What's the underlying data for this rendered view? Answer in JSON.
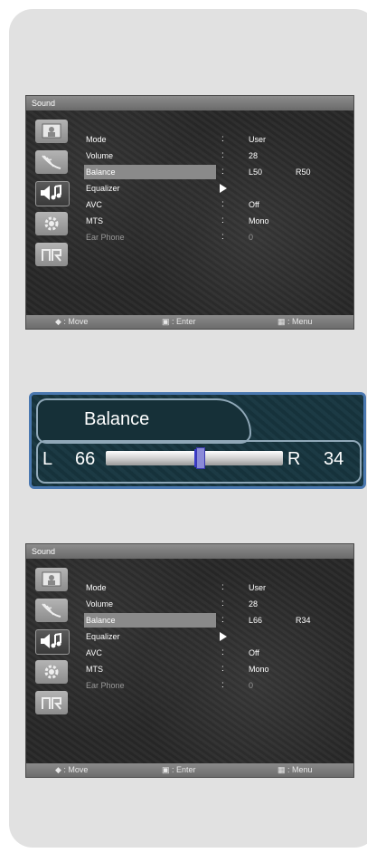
{
  "menus": [
    {
      "title": "Sound",
      "items": [
        {
          "label": "Mode",
          "sep": ":",
          "value": "User",
          "value2": ""
        },
        {
          "label": "Volume",
          "sep": ":",
          "value": "28",
          "value2": ""
        },
        {
          "label": "Balance",
          "sep": ":",
          "value": "L50",
          "value2": "R50",
          "selected": true
        },
        {
          "label": "Equalizer",
          "sep": "",
          "value": "",
          "value2": "",
          "submenu": true
        },
        {
          "label": "AVC",
          "sep": ":",
          "value": "Off",
          "value2": ""
        },
        {
          "label": "MTS",
          "sep": ":",
          "value": "Mono",
          "value2": ""
        },
        {
          "label": "Ear Phone",
          "sep": ":",
          "value": "0",
          "value2": "",
          "disabled": true
        }
      ],
      "footer": {
        "move": "◆ : Move",
        "enter": "▣ : Enter",
        "menu": "▦ : Menu"
      }
    },
    {
      "title": "Sound",
      "items": [
        {
          "label": "Mode",
          "sep": ":",
          "value": "User",
          "value2": ""
        },
        {
          "label": "Volume",
          "sep": ":",
          "value": "28",
          "value2": ""
        },
        {
          "label": "Balance",
          "sep": ":",
          "value": "L66",
          "value2": "R34",
          "selected": true
        },
        {
          "label": "Equalizer",
          "sep": "",
          "value": "",
          "value2": "",
          "submenu": true
        },
        {
          "label": "AVC",
          "sep": ":",
          "value": "Off",
          "value2": ""
        },
        {
          "label": "MTS",
          "sep": ":",
          "value": "Mono",
          "value2": ""
        },
        {
          "label": "Ear Phone",
          "sep": ":",
          "value": "0",
          "value2": "",
          "disabled": true
        }
      ],
      "footer": {
        "move": "◆ : Move",
        "enter": "▣ : Enter",
        "menu": "▦ : Menu"
      }
    }
  ],
  "balance_popup": {
    "title": "Balance",
    "left_label": "L",
    "left_value": "66",
    "right_label": "R",
    "right_value": "34",
    "balance_right_fraction": 0.34
  },
  "icons": [
    "picture-icon",
    "antenna-icon",
    "sound-icon",
    "settings-gear-icon",
    "input-icon"
  ]
}
